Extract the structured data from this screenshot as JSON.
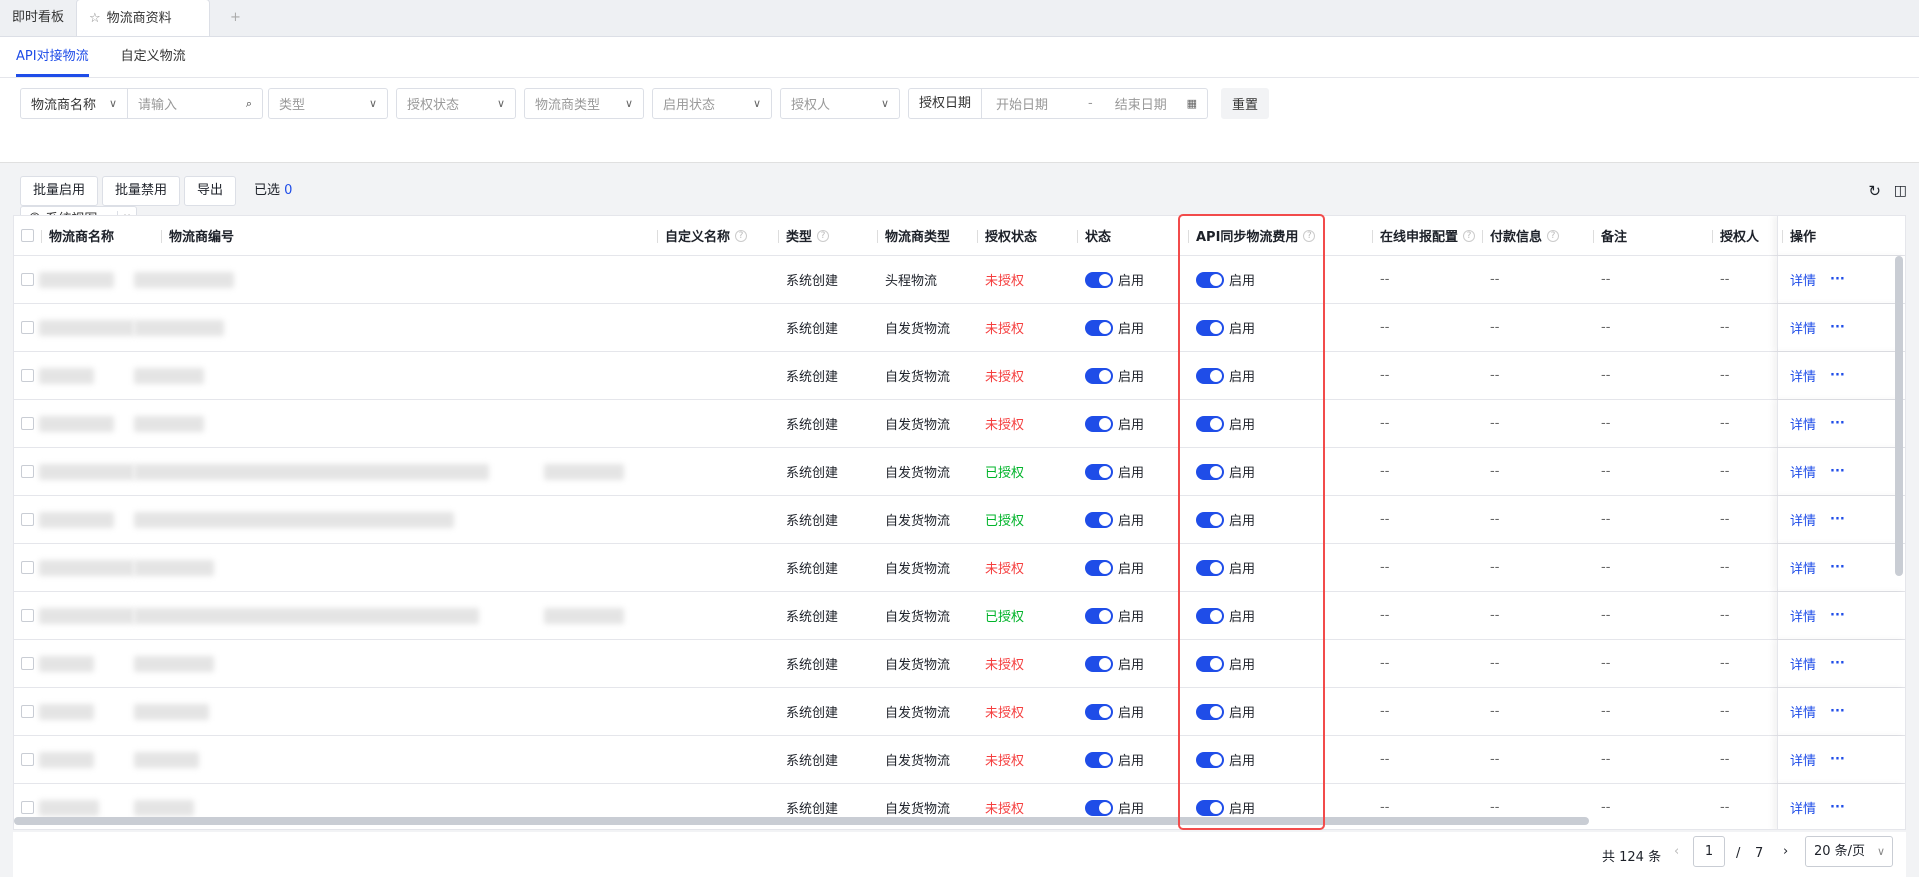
{
  "tabs": {
    "items": [
      "即时看板",
      "物流商资料"
    ],
    "add": "+"
  },
  "subtabs": [
    "API对接物流",
    "自定义物流"
  ],
  "filters": {
    "field_select": "物流商名称",
    "search_placeholder": "请输入",
    "type": "类型",
    "auth_status": "授权状态",
    "logistics_type": "物流商类型",
    "enable_status": "启用状态",
    "authorizer": "授权人",
    "date_label": "授权日期",
    "start_date": "开始日期",
    "sep": "-",
    "end_date": "结束日期",
    "reset": "重置",
    "view": "系统视图"
  },
  "toolbar": {
    "enable": "批量启用",
    "disable": "批量禁用",
    "export": "导出",
    "selected_label": "已选",
    "selected_count": "0"
  },
  "columns": {
    "name": "物流商名称",
    "code": "物流商编号",
    "custom": "自定义名称",
    "type": "类型",
    "ltype": "物流商类型",
    "auth": "授权状态",
    "status": "状态",
    "api": "API同步物流费用",
    "online": "在线申报配置",
    "payment": "付款信息",
    "remark": "备注",
    "authorizer": "授权人",
    "ops": "操作"
  },
  "rows": [
    {
      "type": "系统创建",
      "ltype": "头程物流",
      "auth": "未授权",
      "status": "启用",
      "api": "启用",
      "online": "--",
      "payment": "--",
      "remark": "--",
      "authorizer": "--"
    },
    {
      "type": "系统创建",
      "ltype": "自发货物流",
      "auth": "未授权",
      "status": "启用",
      "api": "启用",
      "online": "--",
      "payment": "--",
      "remark": "--",
      "authorizer": "--"
    },
    {
      "type": "系统创建",
      "ltype": "自发货物流",
      "auth": "未授权",
      "status": "启用",
      "api": "启用",
      "online": "--",
      "payment": "--",
      "remark": "--",
      "authorizer": "--"
    },
    {
      "type": "系统创建",
      "ltype": "自发货物流",
      "auth": "未授权",
      "status": "启用",
      "api": "启用",
      "online": "--",
      "payment": "--",
      "remark": "--",
      "authorizer": "--"
    },
    {
      "type": "系统创建",
      "ltype": "自发货物流",
      "auth": "已授权",
      "status": "启用",
      "api": "启用",
      "online": "--",
      "payment": "--",
      "remark": "--",
      "authorizer": "--"
    },
    {
      "type": "系统创建",
      "ltype": "自发货物流",
      "auth": "已授权",
      "status": "启用",
      "api": "启用",
      "online": "--",
      "payment": "--",
      "remark": "--",
      "authorizer": "--"
    },
    {
      "type": "系统创建",
      "ltype": "自发货物流",
      "auth": "未授权",
      "status": "启用",
      "api": "启用",
      "online": "--",
      "payment": "--",
      "remark": "--",
      "authorizer": "--"
    },
    {
      "type": "系统创建",
      "ltype": "自发货物流",
      "auth": "已授权",
      "status": "启用",
      "api": "启用",
      "online": "--",
      "payment": "--",
      "remark": "--",
      "authorizer": "--"
    },
    {
      "type": "系统创建",
      "ltype": "自发货物流",
      "auth": "未授权",
      "status": "启用",
      "api": "启用",
      "online": "--",
      "payment": "--",
      "remark": "--",
      "authorizer": "--"
    },
    {
      "type": "系统创建",
      "ltype": "自发货物流",
      "auth": "未授权",
      "status": "启用",
      "api": "启用",
      "online": "--",
      "payment": "--",
      "remark": "--",
      "authorizer": "--"
    },
    {
      "type": "系统创建",
      "ltype": "自发货物流",
      "auth": "未授权",
      "status": "启用",
      "api": "启用",
      "online": "--",
      "payment": "--",
      "remark": "--",
      "authorizer": "--"
    },
    {
      "type": "系统创建",
      "ltype": "自发货物流",
      "auth": "未授权",
      "status": "启用",
      "api": "启用",
      "online": "--",
      "payment": "--",
      "remark": "--",
      "authorizer": "--"
    }
  ],
  "row_actions": {
    "detail": "详情",
    "more": "···"
  },
  "pagination": {
    "total": "共 124 条",
    "page": "1",
    "sep": "/",
    "pages": "7",
    "size": "20 条/页",
    "prev": "‹",
    "next": "›"
  },
  "colors": {
    "primary": "#1f4de8",
    "unauth": "#f53f3f",
    "auth": "#00b42a",
    "highlight": "#f24b4b"
  }
}
